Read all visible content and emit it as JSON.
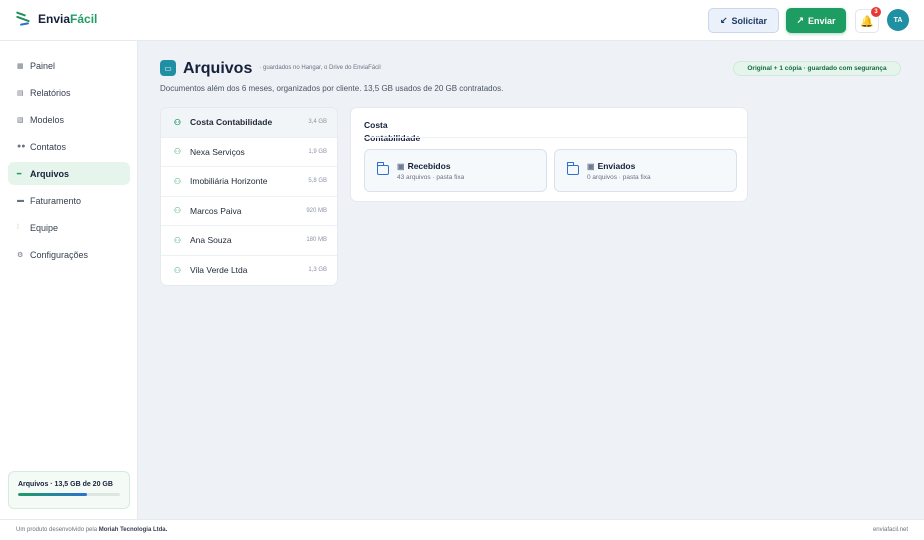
{
  "app": {
    "brand_prefix": "Envia",
    "brand_accent": "Fácil"
  },
  "header": {
    "solicitar_label": "Solicitar",
    "enviar_label": "Enviar",
    "notifications_count": "3",
    "avatar_initials": "TA"
  },
  "sidebar": {
    "items": [
      {
        "label": "Painel",
        "icon": "dashboard-icon",
        "active": false
      },
      {
        "label": "Relatórios",
        "icon": "chart-icon",
        "active": false
      },
      {
        "label": "Modelos",
        "icon": "template-icon",
        "active": false
      },
      {
        "label": "Contatos",
        "icon": "contacts-icon",
        "active": false
      },
      {
        "label": "Arquivos",
        "icon": "files-icon",
        "active": true
      },
      {
        "label": "Faturamento",
        "icon": "billing-icon",
        "active": false
      },
      {
        "label": "Equipe",
        "icon": "team-icon",
        "active": false
      },
      {
        "label": "Configurações",
        "icon": "gear-icon",
        "active": false
      }
    ],
    "storage": {
      "label": "Arquivos · 13,5 GB de 20 GB",
      "fraction": 0.675
    }
  },
  "page": {
    "title": "Arquivos",
    "subtitle": "· guardados no Hangar, o Drive do EnviaFácil",
    "description": "Documentos além dos 6 meses, organizados por cliente. 13,5 GB usados de 20 GB contratados.",
    "secure_badge": "Original + 1 cópia · guardado com segurança"
  },
  "clients": [
    {
      "name": "Costa Contabilidade",
      "size": "3,4 GB",
      "active": true
    },
    {
      "name": "Nexa Serviços",
      "size": "1,9 GB",
      "active": false
    },
    {
      "name": "Imobiliária Horizonte",
      "size": "5,8 GB",
      "active": false
    },
    {
      "name": "Marcos Paiva",
      "size": "920 MB",
      "active": false
    },
    {
      "name": "Ana Souza",
      "size": "180 MB",
      "active": false
    },
    {
      "name": "Vila Verde Ltda",
      "size": "1,3 GB",
      "active": false
    }
  ],
  "detail": {
    "client_title": "Costa Contabilidade",
    "folders": [
      {
        "name": "Recebidos",
        "meta": "43 arquivos · pasta fixa",
        "icon": "inbox-icon"
      },
      {
        "name": "Enviados",
        "meta": "0 arquivos · pasta fixa",
        "icon": "outbox-icon"
      }
    ]
  },
  "footer": {
    "left_prefix": "Um produto desenvolvido pela",
    "left_company": "Moriah Tecnologia Ltda.",
    "right": "enviafacil.net"
  },
  "colors": {
    "accent": "#1e9d63",
    "brand_dark": "#15213a",
    "active_bg": "#e5f5ec",
    "badge_red": "#e53935",
    "avatar": "#1f8fa3"
  }
}
